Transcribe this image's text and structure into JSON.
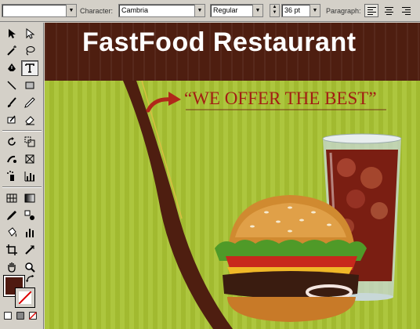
{
  "control_bar": {
    "character_label": "Character:",
    "font_family": "Cambria",
    "font_style": "Regular",
    "font_size": "36 pt",
    "paragraph_label": "Paragraph:"
  },
  "toolbox": {
    "fill_color": "#4e1a10",
    "stroke": "none"
  },
  "artboard": {
    "headline": "FastFood Restaurant",
    "tagline": "“WE OFFER THE BEST”",
    "colors": {
      "background_green": "#a8c232",
      "band_brown": "#4e1e10",
      "tagline_red": "#a31c14"
    }
  }
}
